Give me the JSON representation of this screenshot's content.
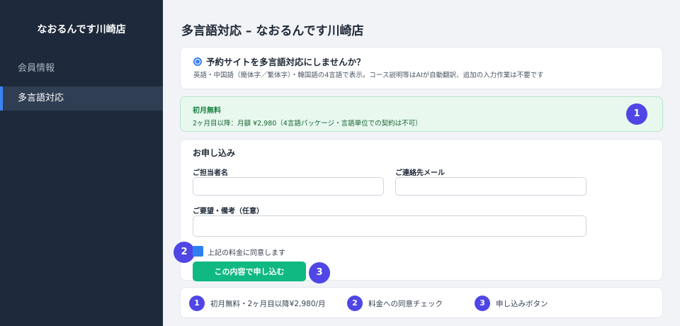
{
  "sidebar": {
    "store_name": "なおるんです川崎店",
    "items": [
      {
        "label": "会員情報",
        "active": false
      },
      {
        "label": "多言語対応",
        "active": true
      }
    ]
  },
  "main": {
    "title": "多言語対応 – なおるんです川崎店",
    "promo": {
      "icon": "globe-icon",
      "heading": "予約サイトを多言語対応にしませんか？",
      "body": "英語・中国語（簡体字／繁体字）・韓国語の4言語で表示。コース説明等はAIが自動翻訳、追加の入力作業は不要です"
    },
    "pricing": {
      "title": "初月無料",
      "detail": "2ヶ月目以降：月額 ¥2,980（4言語パッケージ・言語単位での契約は不可）",
      "badge": "1"
    },
    "form": {
      "title": "お申し込み",
      "contact_label": "ご担当者名",
      "contact_value": "",
      "email_label": "ご連絡先メール",
      "email_value": "",
      "notes_label": "ご要望・備考（任意）",
      "notes_value": "",
      "agree_label": "上記の料金に同意します",
      "agree_checked": true,
      "agree_badge": "2",
      "submit_label": "この内容で申し込む",
      "submit_badge": "3"
    },
    "legend": [
      {
        "num": "1",
        "text": "初月無料・2ヶ月目以降¥2,980/月"
      },
      {
        "num": "2",
        "text": "料金への同意チェック"
      },
      {
        "num": "3",
        "text": "申し込みボタン"
      }
    ]
  },
  "colors": {
    "sidebar_bg": "#1e2a3b",
    "accent_blue": "#3b82f6",
    "submit_green": "#10b981",
    "badge_purple": "#4f46e5",
    "price_bg": "#e8f8ef"
  }
}
